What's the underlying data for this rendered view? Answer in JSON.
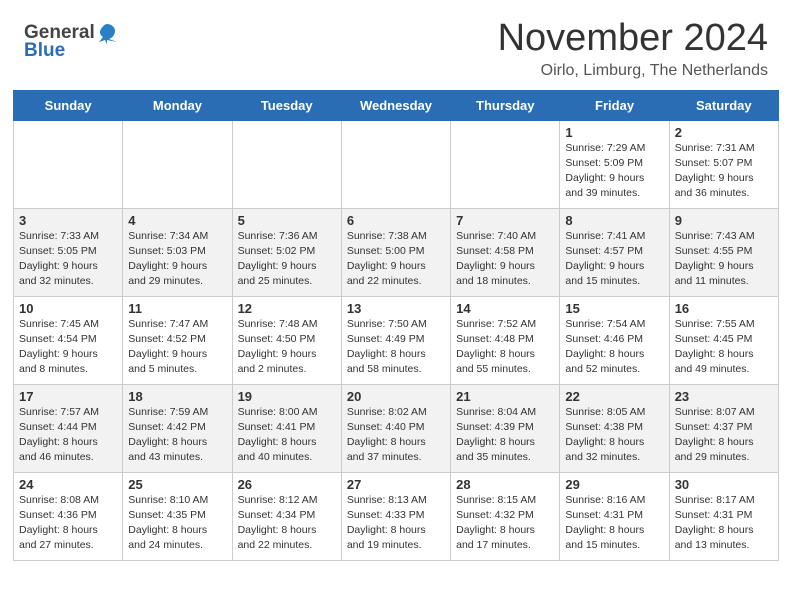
{
  "logo": {
    "general": "General",
    "blue": "Blue"
  },
  "title": "November 2024",
  "location": "Oirlo, Limburg, The Netherlands",
  "headers": [
    "Sunday",
    "Monday",
    "Tuesday",
    "Wednesday",
    "Thursday",
    "Friday",
    "Saturday"
  ],
  "weeks": [
    [
      {
        "day": "",
        "info": ""
      },
      {
        "day": "",
        "info": ""
      },
      {
        "day": "",
        "info": ""
      },
      {
        "day": "",
        "info": ""
      },
      {
        "day": "",
        "info": ""
      },
      {
        "day": "1",
        "info": "Sunrise: 7:29 AM\nSunset: 5:09 PM\nDaylight: 9 hours and 39 minutes."
      },
      {
        "day": "2",
        "info": "Sunrise: 7:31 AM\nSunset: 5:07 PM\nDaylight: 9 hours and 36 minutes."
      }
    ],
    [
      {
        "day": "3",
        "info": "Sunrise: 7:33 AM\nSunset: 5:05 PM\nDaylight: 9 hours and 32 minutes."
      },
      {
        "day": "4",
        "info": "Sunrise: 7:34 AM\nSunset: 5:03 PM\nDaylight: 9 hours and 29 minutes."
      },
      {
        "day": "5",
        "info": "Sunrise: 7:36 AM\nSunset: 5:02 PM\nDaylight: 9 hours and 25 minutes."
      },
      {
        "day": "6",
        "info": "Sunrise: 7:38 AM\nSunset: 5:00 PM\nDaylight: 9 hours and 22 minutes."
      },
      {
        "day": "7",
        "info": "Sunrise: 7:40 AM\nSunset: 4:58 PM\nDaylight: 9 hours and 18 minutes."
      },
      {
        "day": "8",
        "info": "Sunrise: 7:41 AM\nSunset: 4:57 PM\nDaylight: 9 hours and 15 minutes."
      },
      {
        "day": "9",
        "info": "Sunrise: 7:43 AM\nSunset: 4:55 PM\nDaylight: 9 hours and 11 minutes."
      }
    ],
    [
      {
        "day": "10",
        "info": "Sunrise: 7:45 AM\nSunset: 4:54 PM\nDaylight: 9 hours and 8 minutes."
      },
      {
        "day": "11",
        "info": "Sunrise: 7:47 AM\nSunset: 4:52 PM\nDaylight: 9 hours and 5 minutes."
      },
      {
        "day": "12",
        "info": "Sunrise: 7:48 AM\nSunset: 4:50 PM\nDaylight: 9 hours and 2 minutes."
      },
      {
        "day": "13",
        "info": "Sunrise: 7:50 AM\nSunset: 4:49 PM\nDaylight: 8 hours and 58 minutes."
      },
      {
        "day": "14",
        "info": "Sunrise: 7:52 AM\nSunset: 4:48 PM\nDaylight: 8 hours and 55 minutes."
      },
      {
        "day": "15",
        "info": "Sunrise: 7:54 AM\nSunset: 4:46 PM\nDaylight: 8 hours and 52 minutes."
      },
      {
        "day": "16",
        "info": "Sunrise: 7:55 AM\nSunset: 4:45 PM\nDaylight: 8 hours and 49 minutes."
      }
    ],
    [
      {
        "day": "17",
        "info": "Sunrise: 7:57 AM\nSunset: 4:44 PM\nDaylight: 8 hours and 46 minutes."
      },
      {
        "day": "18",
        "info": "Sunrise: 7:59 AM\nSunset: 4:42 PM\nDaylight: 8 hours and 43 minutes."
      },
      {
        "day": "19",
        "info": "Sunrise: 8:00 AM\nSunset: 4:41 PM\nDaylight: 8 hours and 40 minutes."
      },
      {
        "day": "20",
        "info": "Sunrise: 8:02 AM\nSunset: 4:40 PM\nDaylight: 8 hours and 37 minutes."
      },
      {
        "day": "21",
        "info": "Sunrise: 8:04 AM\nSunset: 4:39 PM\nDaylight: 8 hours and 35 minutes."
      },
      {
        "day": "22",
        "info": "Sunrise: 8:05 AM\nSunset: 4:38 PM\nDaylight: 8 hours and 32 minutes."
      },
      {
        "day": "23",
        "info": "Sunrise: 8:07 AM\nSunset: 4:37 PM\nDaylight: 8 hours and 29 minutes."
      }
    ],
    [
      {
        "day": "24",
        "info": "Sunrise: 8:08 AM\nSunset: 4:36 PM\nDaylight: 8 hours and 27 minutes."
      },
      {
        "day": "25",
        "info": "Sunrise: 8:10 AM\nSunset: 4:35 PM\nDaylight: 8 hours and 24 minutes."
      },
      {
        "day": "26",
        "info": "Sunrise: 8:12 AM\nSunset: 4:34 PM\nDaylight: 8 hours and 22 minutes."
      },
      {
        "day": "27",
        "info": "Sunrise: 8:13 AM\nSunset: 4:33 PM\nDaylight: 8 hours and 19 minutes."
      },
      {
        "day": "28",
        "info": "Sunrise: 8:15 AM\nSunset: 4:32 PM\nDaylight: 8 hours and 17 minutes."
      },
      {
        "day": "29",
        "info": "Sunrise: 8:16 AM\nSunset: 4:31 PM\nDaylight: 8 hours and 15 minutes."
      },
      {
        "day": "30",
        "info": "Sunrise: 8:17 AM\nSunset: 4:31 PM\nDaylight: 8 hours and 13 minutes."
      }
    ]
  ]
}
